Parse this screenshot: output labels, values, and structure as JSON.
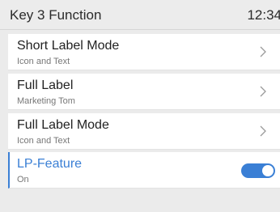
{
  "header": {
    "title": "Key 3 Function",
    "time": "12:34"
  },
  "items": [
    {
      "title": "Short Label Mode",
      "subtitle": "Icon and Text",
      "control": "chevron-right-icon"
    },
    {
      "title": "Full Label",
      "subtitle": "Marketing Tom",
      "control": "chevron-right-icon"
    },
    {
      "title": "Full Label Mode",
      "subtitle": "Icon and Text",
      "control": "chevron-right-icon"
    },
    {
      "title": "LP-Feature",
      "subtitle": "On",
      "control": "toggle-switch",
      "toggle_on": true,
      "selected": true
    }
  ],
  "colors": {
    "accent": "#3a7fd5",
    "background": "#ebebeb",
    "item_background": "#ffffff"
  }
}
